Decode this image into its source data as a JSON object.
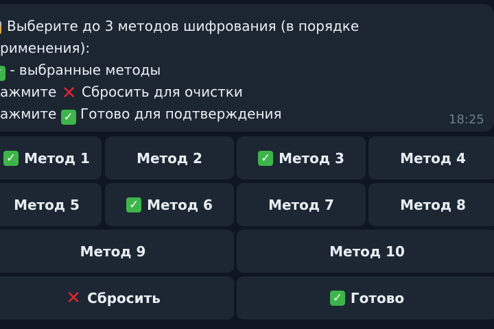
{
  "message": {
    "line1": "Выберите до 3 методов шифрования (в порядке",
    "line2": "рименения):",
    "line3": " - выбранные методы",
    "line4_a": "ажмите ",
    "line4_b": " Сбросить для очистки",
    "line5_a": "ажмите ",
    "line5_b": " Готово для подтверждения",
    "time": "18:25"
  },
  "icons": {
    "lock": "lock-icon",
    "check": "✓",
    "cross": "✕"
  },
  "keyboard": {
    "row1": [
      {
        "label": "Метод 1",
        "selected": true
      },
      {
        "label": "Метод 2",
        "selected": false
      },
      {
        "label": "Метод 3",
        "selected": true
      },
      {
        "label": "Метод 4",
        "selected": false
      }
    ],
    "row2": [
      {
        "label": "Метод 5",
        "selected": false
      },
      {
        "label": "Метод 6",
        "selected": true
      },
      {
        "label": "Метод 7",
        "selected": false
      },
      {
        "label": "Метод 8",
        "selected": false
      }
    ],
    "row3": [
      {
        "label": "Метод 9",
        "selected": false
      },
      {
        "label": "Метод 10",
        "selected": false
      }
    ],
    "reset_label": "Сбросить",
    "done_label": "Готово"
  },
  "colors": {
    "background": "#0e1621",
    "bubble": "#1b2631",
    "button": "#1c2733",
    "check_green": "#3eb54a",
    "cross_red": "#e0262f"
  }
}
